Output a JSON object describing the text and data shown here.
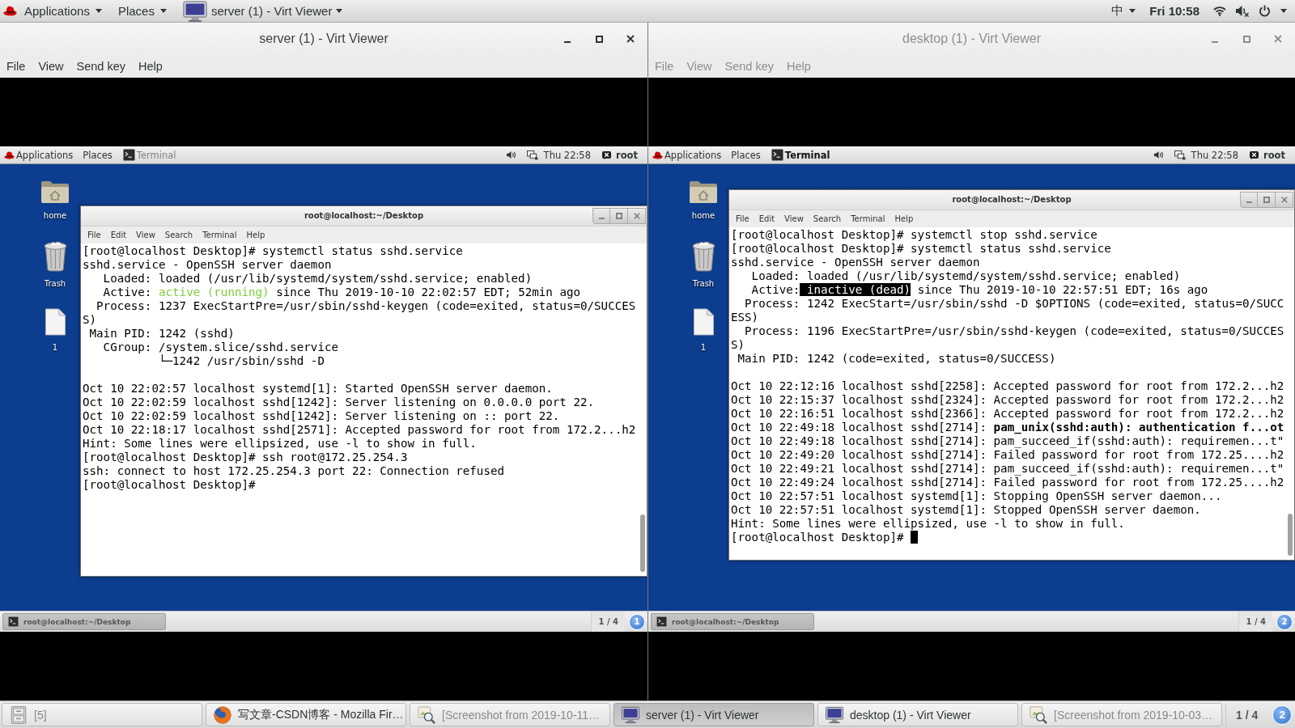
{
  "top_bar": {
    "menus": [
      "Applications",
      "Places"
    ],
    "window_menu": "server (1) - Virt Viewer",
    "input_method": "中",
    "clock": "Fri 10:58"
  },
  "viewers": [
    {
      "title": "server (1) - Virt Viewer",
      "active": true,
      "menu": [
        "File",
        "View",
        "Send key",
        "Help"
      ],
      "vm": {
        "panel": {
          "menus": [
            "Applications",
            "Places"
          ],
          "task": {
            "label": "Terminal",
            "selected": false
          },
          "clock": "Thu 22:58",
          "user": "root"
        },
        "desktop_icons": [
          {
            "kind": "home",
            "label": "home"
          },
          {
            "kind": "trash",
            "label": "Trash"
          },
          {
            "kind": "file",
            "label": "1"
          }
        ],
        "terminal": {
          "title": "root@localhost:~/Desktop",
          "menu": [
            "File",
            "Edit",
            "View",
            "Search",
            "Terminal",
            "Help"
          ],
          "blocks": [
            {
              "lines": [
                {
                  "text": "[root@localhost Desktop]# systemctl status sshd.service"
                },
                {
                  "text": "sshd.service - OpenSSH server daemon"
                },
                {
                  "text": "   Loaded: loaded (/usr/lib/systemd/system/sshd.service; enabled)"
                },
                {
                  "parts": [
                    {
                      "kind": "plain",
                      "text": "   Active: "
                    },
                    {
                      "kind": "ok",
                      "text": "active (running)"
                    },
                    {
                      "kind": "plain",
                      "text": " since Thu 2019-10-10 22:02:57 EDT; 52min ago"
                    }
                  ]
                },
                {
                  "text": "  Process: 1237 ExecStartPre=/usr/sbin/sshd-keygen (code=exited, status=0/SUCCES"
                },
                {
                  "text": "S)"
                },
                {
                  "text": " Main PID: 1242 (sshd)"
                },
                {
                  "text": "   CGroup: /system.slice/sshd.service"
                },
                {
                  "text": "           └─1242 /usr/sbin/sshd -D"
                }
              ]
            },
            {
              "lines": [
                {
                  "text": "Oct 10 22:02:57 localhost systemd[1]: Started OpenSSH server daemon."
                },
                {
                  "text": "Oct 10 22:02:59 localhost sshd[1242]: Server listening on 0.0.0.0 port 22."
                },
                {
                  "text": "Oct 10 22:02:59 localhost sshd[1242]: Server listening on :: port 22."
                },
                {
                  "text": "Oct 10 22:18:17 localhost sshd[2571]: Accepted password for root from 172.2...h2"
                },
                {
                  "text": "Hint: Some lines were ellipsized, use -l to show in full."
                },
                {
                  "text": "[root@localhost Desktop]# ssh root@172.25.254.3"
                },
                {
                  "text": "ssh: connect to host 172.25.254.3 port 22: Connection refused"
                },
                {
                  "text": "[root@localhost Desktop]#"
                }
              ]
            }
          ]
        },
        "bottom_panel": {
          "task": "root@localhost:~/Desktop",
          "workspace": "1 / 4",
          "badge": "1"
        }
      }
    },
    {
      "title": "desktop (1) - Virt Viewer",
      "active": false,
      "menu": [
        "File",
        "View",
        "Send key",
        "Help"
      ],
      "vm": {
        "panel": {
          "menus": [
            "Applications",
            "Places"
          ],
          "task": {
            "label": "Terminal",
            "selected": true
          },
          "clock": "Thu 22:58",
          "user": "root"
        },
        "desktop_icons": [
          {
            "kind": "home",
            "label": "home"
          },
          {
            "kind": "trash",
            "label": "Trash"
          },
          {
            "kind": "file",
            "label": "1"
          }
        ],
        "terminal": {
          "title": "root@localhost:~/Desktop",
          "menu": [
            "File",
            "Edit",
            "View",
            "Search",
            "Terminal",
            "Help"
          ],
          "cursor": true,
          "blocks": [
            {
              "lines": [
                {
                  "text": "[root@localhost Desktop]# systemctl stop sshd.service"
                },
                {
                  "text": "[root@localhost Desktop]# systemctl status sshd.service"
                },
                {
                  "text": "sshd.service - OpenSSH server daemon"
                },
                {
                  "text": "   Loaded: loaded (/usr/lib/systemd/system/sshd.service; enabled)"
                },
                {
                  "parts": [
                    {
                      "kind": "plain",
                      "text": "   Active:"
                    },
                    {
                      "kind": "selection",
                      "text": " inactive (dead)"
                    },
                    {
                      "kind": "plain",
                      "text": " since Thu 2019-10-10 22:57:51 EDT; 16s ago"
                    }
                  ]
                },
                {
                  "text": "  Process: 1242 ExecStart=/usr/sbin/sshd -D $OPTIONS (code=exited, status=0/SUCC"
                },
                {
                  "text": "ESS)"
                },
                {
                  "text": "  Process: 1196 ExecStartPre=/usr/sbin/sshd-keygen (code=exited, status=0/SUCCES"
                },
                {
                  "text": "S)"
                },
                {
                  "text": " Main PID: 1242 (code=exited, status=0/SUCCESS)"
                }
              ]
            },
            {
              "lines": [
                {
                  "text": "Oct 10 22:12:16 localhost sshd[2258]: Accepted password for root from 172.2...h2"
                },
                {
                  "text": "Oct 10 22:15:37 localhost sshd[2324]: Accepted password for root from 172.2...h2"
                },
                {
                  "text": "Oct 10 22:16:51 localhost sshd[2366]: Accepted password for root from 172.2...h2"
                },
                {
                  "text": "Oct 10 22:49:18 localhost sshd[2714]: **pam_unix(sshd:auth): authentication f...ot**"
                },
                {
                  "text": "Oct 10 22:49:18 localhost sshd[2714]: pam_succeed_if(sshd:auth): requiremen...t\""
                },
                {
                  "text": "Oct 10 22:49:20 localhost sshd[2714]: Failed password for root from 172.25....h2"
                },
                {
                  "text": "Oct 10 22:49:21 localhost sshd[2714]: pam_succeed_if(sshd:auth): requiremen...t\""
                },
                {
                  "text": "Oct 10 22:49:24 localhost sshd[2714]: Failed password for root from 172.25....h2"
                },
                {
                  "text": "Oct 10 22:57:51 localhost systemd[1]: Stopping OpenSSH server daemon..."
                },
                {
                  "text": "Oct 10 22:57:51 localhost systemd[1]: Stopped OpenSSH server daemon."
                },
                {
                  "text": "Hint: Some lines were ellipsized, use -l to show in full."
                },
                {
                  "text": "[root@localhost Desktop]#"
                }
              ]
            }
          ]
        },
        "bottom_panel": {
          "task": "root@localhost:~/Desktop",
          "workspace": "1 / 4",
          "badge": "2"
        }
      }
    }
  ],
  "taskbar": {
    "items": [
      {
        "kind": "drawer",
        "label": "[5]",
        "minimized": true,
        "selected": false
      },
      {
        "kind": "browser",
        "label": "写文章-CSDN博客 - Mozilla Fir…",
        "minimized": false,
        "selected": false
      },
      {
        "kind": "screenshot",
        "label": "[Screenshot from 2019-10-11…",
        "minimized": true,
        "selected": false
      },
      {
        "kind": "viewer",
        "label": "server (1) - Virt Viewer",
        "minimized": false,
        "selected": true
      },
      {
        "kind": "viewer",
        "label": "desktop (1) - Virt Viewer",
        "minimized": false,
        "selected": false
      },
      {
        "kind": "screenshot",
        "label": "[Screenshot from 2019-10-03…",
        "minimized": true,
        "selected": false
      }
    ],
    "workspace": "1 / 4",
    "badge": "2"
  }
}
